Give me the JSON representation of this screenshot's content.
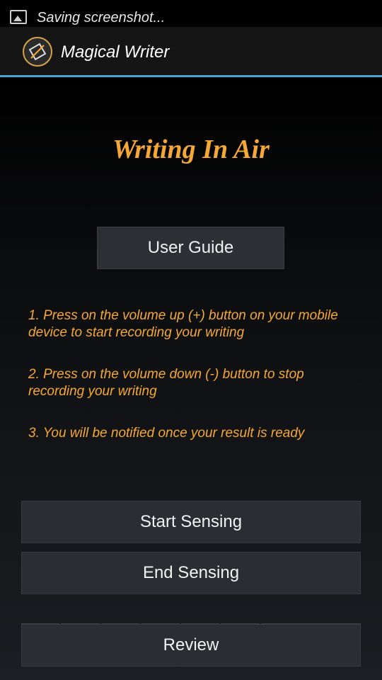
{
  "status_bar": {
    "notification_text": "Saving screenshot..."
  },
  "action_bar": {
    "app_title": "Magical Writer"
  },
  "main": {
    "heading": "Writing In Air",
    "user_guide_label": "User Guide",
    "instructions": [
      "1. Press on the volume up (+) button on your mobile device to start recording your writing",
      "2. Press on the volume down (-) button to stop recording your writing",
      "3. You will be notified once your result is ready"
    ],
    "start_label": "Start Sensing",
    "end_label": "End Sensing",
    "review_label": "Review"
  },
  "colors": {
    "accent": "#f6a836",
    "actionbar_line": "#4aa3d9"
  }
}
